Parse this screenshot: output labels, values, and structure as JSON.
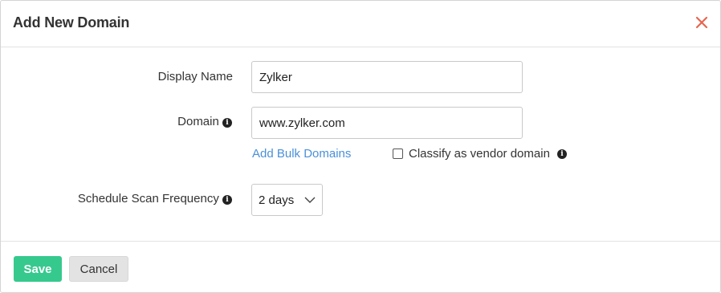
{
  "dialog": {
    "title": "Add New Domain",
    "close_icon": "close-icon",
    "close_color": "#e8654f"
  },
  "form": {
    "display_name": {
      "label": "Display Name",
      "value": "Zylker"
    },
    "domain": {
      "label": "Domain",
      "info_icon": "info-icon",
      "value": "www.zylker.com"
    },
    "add_bulk_domains_link": "Add Bulk Domains",
    "classify_vendor": {
      "label": "Classify as vendor domain",
      "checked": false,
      "info_icon": "info-icon"
    },
    "schedule_scan": {
      "label": "Schedule Scan Frequency",
      "info_icon": "info-icon",
      "selected": "2 days",
      "dropdown_icon": "chevron-down-icon"
    }
  },
  "footer": {
    "save_label": "Save",
    "cancel_label": "Cancel"
  },
  "colors": {
    "accent_save": "#36c98e",
    "link": "#4a90d9"
  }
}
